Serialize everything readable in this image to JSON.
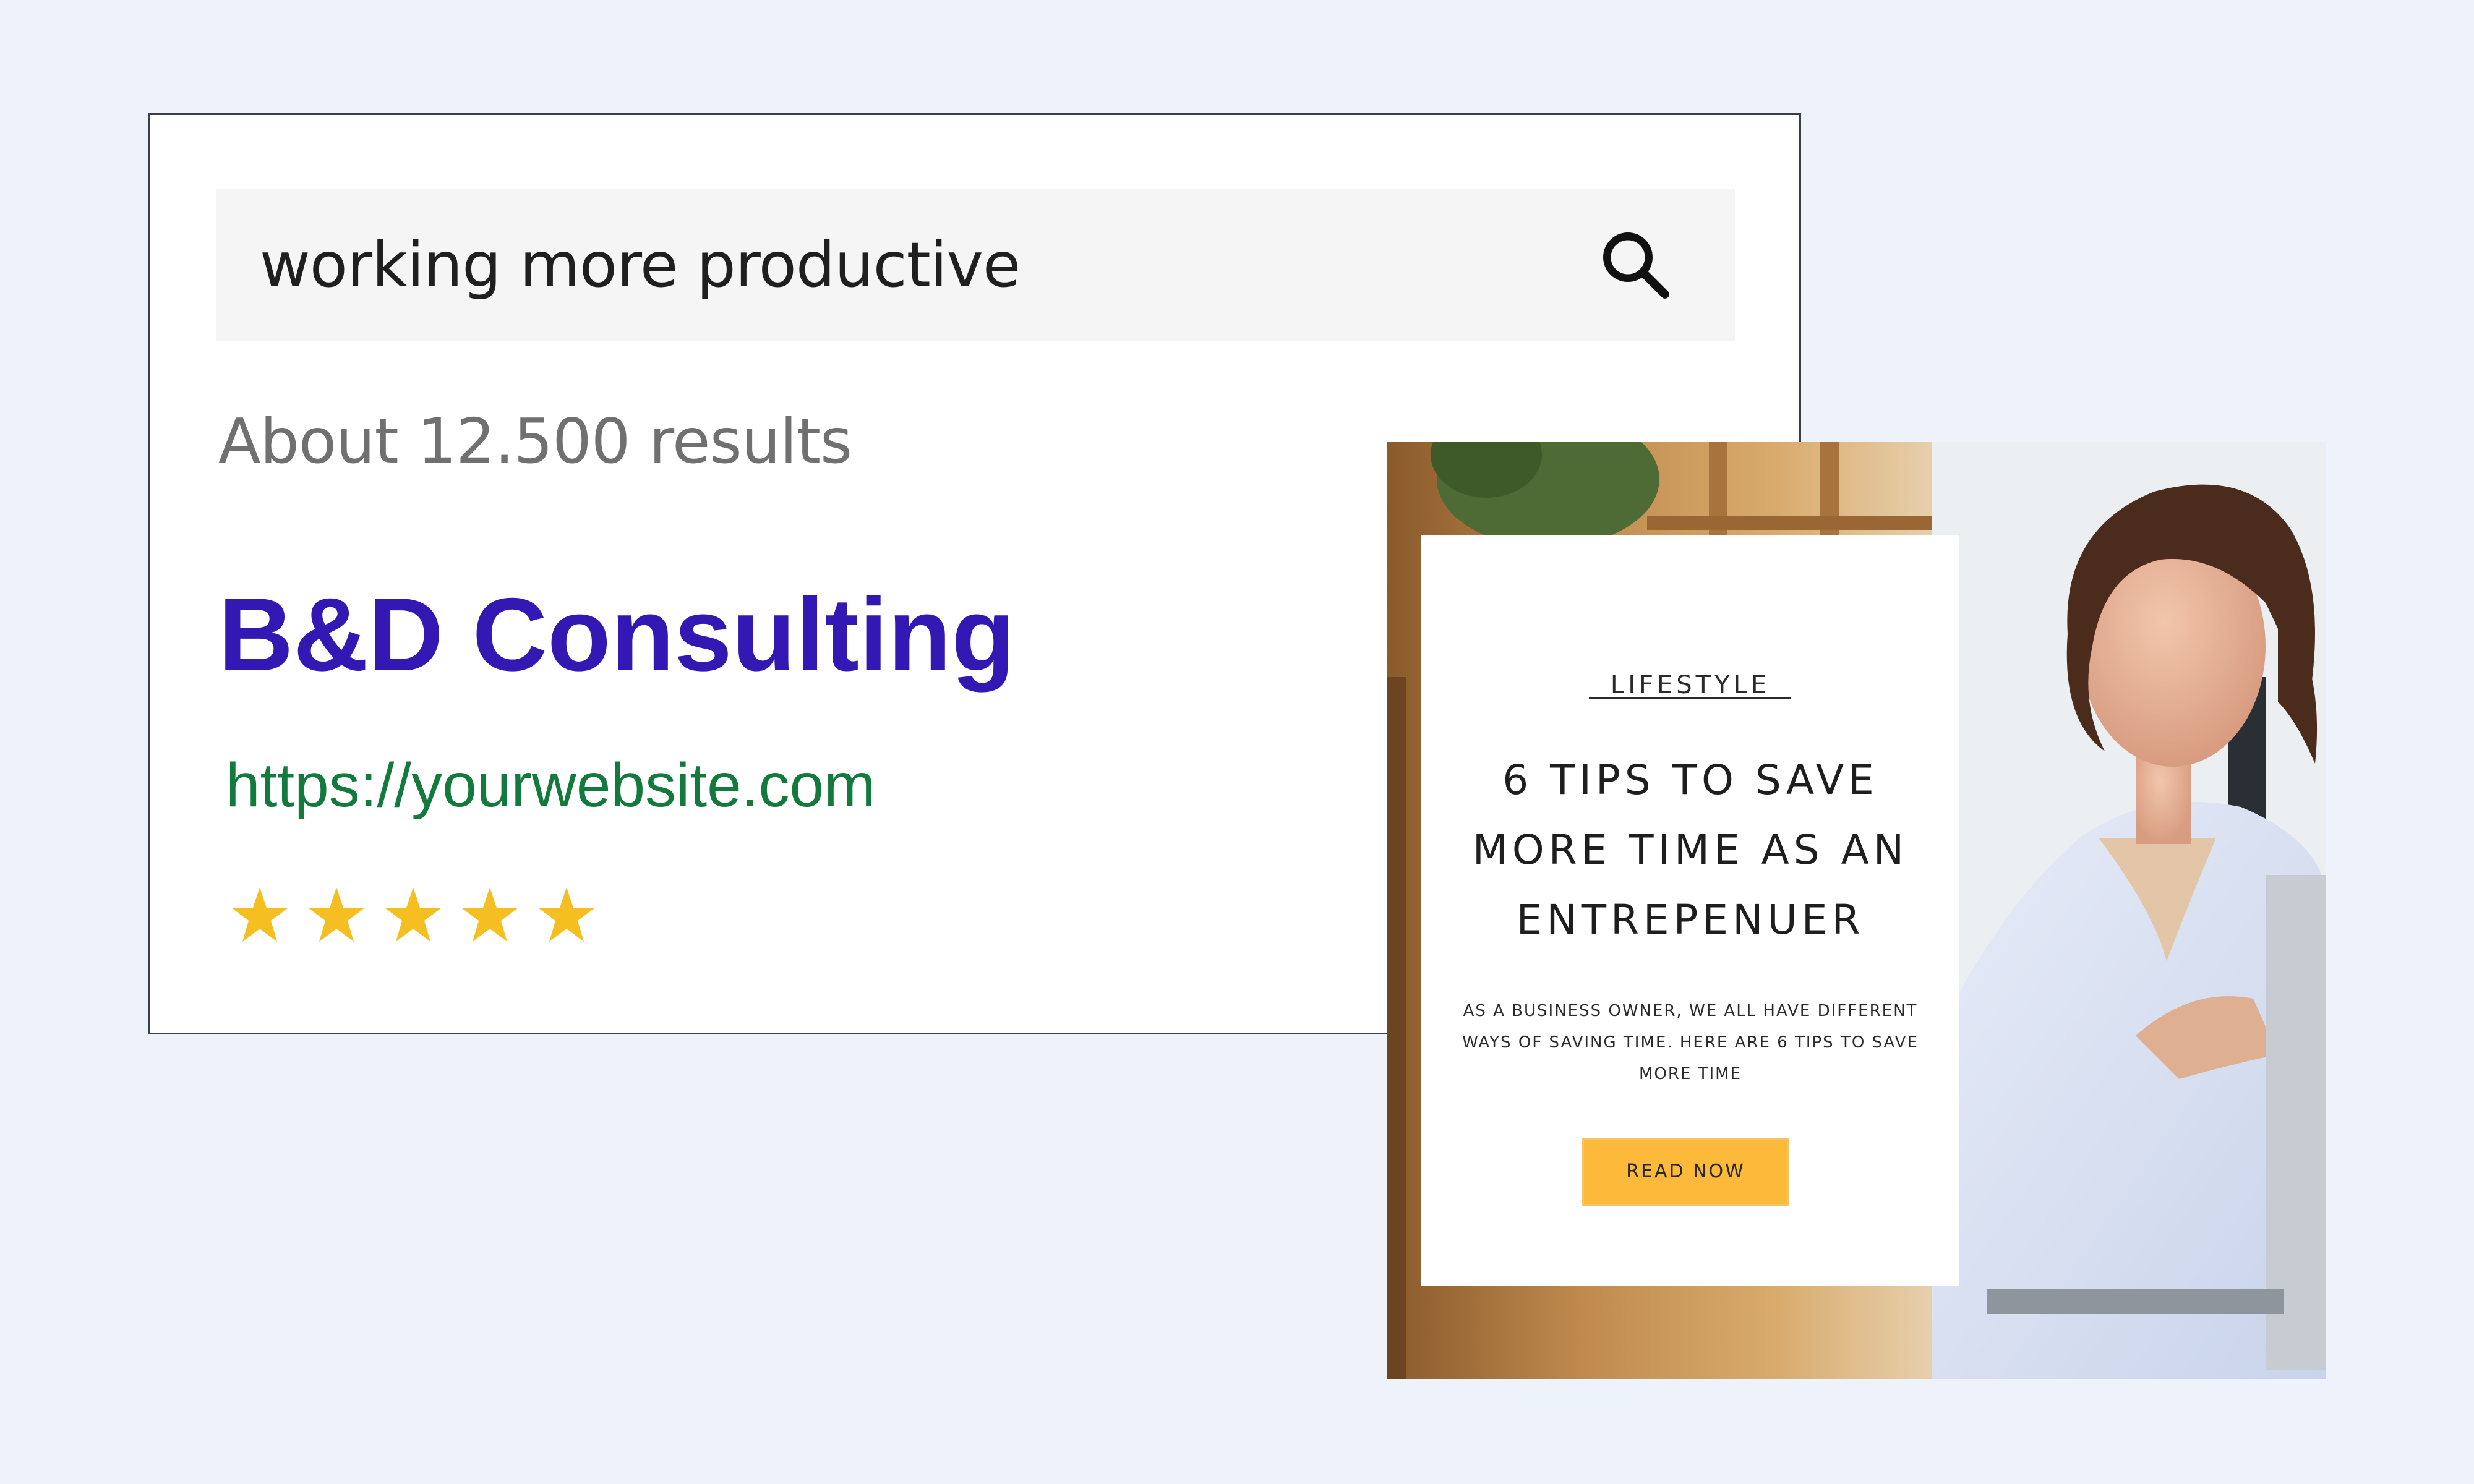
{
  "search": {
    "query": "working more productive",
    "icon": "search-icon"
  },
  "results": {
    "count_text": "About 12.500 results",
    "title": "B&D Consulting",
    "url": "https://yourwebsite.com",
    "rating": 5,
    "rating_max": 5,
    "star_color": "#f5bf21"
  },
  "blog": {
    "category": "LIFESTYLE",
    "headline": "6 TIPS TO SAVE MORE TIME AS AN ENTREPENUER",
    "excerpt": "AS A BUSINESS OWNER, WE ALL HAVE DIFFERENT WAYS OF SAVING TIME. HERE ARE 6 TIPS TO SAVE MORE TIME",
    "button_label": "READ NOW",
    "button_color": "#fcb93a"
  },
  "colors": {
    "background": "#eef2fa",
    "title": "#3318b4",
    "url": "#127a3c",
    "results_count": "#707070"
  }
}
